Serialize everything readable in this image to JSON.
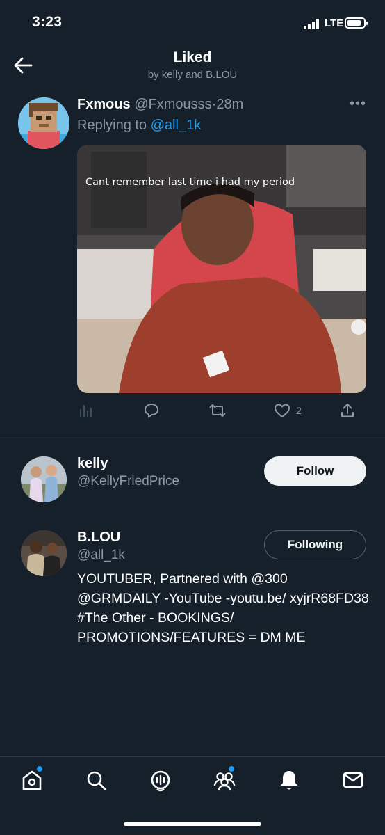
{
  "status_bar": {
    "time": "3:23",
    "network": "LTE",
    "icons": [
      "signal-icon",
      "battery-icon"
    ]
  },
  "header": {
    "title": "Liked",
    "subtitle": "by kelly and B.LOU"
  },
  "tweet": {
    "display_name": "Fxmous",
    "handle": "@Fxmousss",
    "separator": "·",
    "time": "28m",
    "replying_prefix": "Replying to",
    "replying_to": "@all_1k",
    "media_caption": "Cant remember last time i had my period",
    "likes": "2",
    "actions": [
      "analytics-icon",
      "reply-icon",
      "retweet-icon",
      "like-icon",
      "share-icon"
    ]
  },
  "users": [
    {
      "name": "kelly",
      "handle": "@KellyFriedPrice",
      "button": "Follow"
    },
    {
      "name": "B.LOU",
      "handle": "@all_1k",
      "button": "Following",
      "bio": "YOUTUBER, Partnered with @300 @GRMDAILY -YouTube -youtu.be/ xyjrR68FD38 #The Other - BOOKINGS/ PROMOTIONS/FEATURES = DM ME"
    }
  ],
  "tab_bar": [
    "home-icon",
    "search-icon",
    "spaces-icon",
    "communities-icon",
    "notifications-icon",
    "messages-icon"
  ],
  "colors": {
    "background": "#15202b",
    "accent": "#1d9bf0",
    "muted": "#8b98a5"
  }
}
